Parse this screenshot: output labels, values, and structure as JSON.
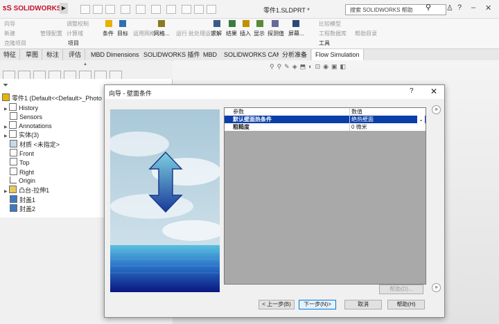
{
  "app": {
    "brand": "SOLIDWORKS",
    "document_title": "零件1.SLDPRT *"
  },
  "search": {
    "placeholder": "搜索 SOLIDWORKS 帮助"
  },
  "ribbon": {
    "left_items": [
      "向导",
      "新建",
      "克隆项目",
      "管理配置",
      "调整校制",
      "计算域",
      "条件",
      "目标",
      "项目",
      "运用网格",
      "网格...",
      "运行",
      "批处理运行",
      "求解",
      "结果",
      "插入",
      "显示",
      "探测值",
      "屏幕...",
      "比较模型",
      "工程数据库",
      "工具",
      "帮助目录"
    ]
  },
  "tabs": [
    {
      "label": "特征",
      "active": false
    },
    {
      "label": "草图",
      "active": false
    },
    {
      "label": "标注",
      "active": false
    },
    {
      "label": "评估",
      "active": false
    },
    {
      "label": "MBD Dimensions",
      "active": false
    },
    {
      "label": "SOLIDWORKS 插件",
      "active": false
    },
    {
      "label": "MBD",
      "active": false
    },
    {
      "label": "SOLIDWORKS CAM",
      "active": false
    },
    {
      "label": "分析准备",
      "active": false
    },
    {
      "label": "Flow Simulation",
      "active": true
    }
  ],
  "tree": {
    "root": "零件1 (Default<<Default>_Photo",
    "items": [
      "History",
      "Sensors",
      "Annotations",
      "实体(3)",
      "材质 <未指定>",
      "Front",
      "Top",
      "Right",
      "Origin",
      "凸台-拉伸1",
      "封盖1",
      "封盖2"
    ]
  },
  "dialog": {
    "title": "向导 - 壁面条件",
    "help": "?",
    "grid_header": {
      "param": "参数",
      "value": "数值"
    },
    "rows": [
      {
        "param": "默认壁面热条件",
        "value": "绝热壁面",
        "selected": true
      },
      {
        "param": "粗糙度",
        "value": "0 微米",
        "selected": false
      }
    ],
    "buttons": {
      "back": "< 上一步(B)",
      "next": "下一步(N)>",
      "cancel": "取消",
      "help": "帮助(H)",
      "grid_disabled": "帮助(D)..."
    }
  },
  "colors": {
    "selected_row": "#0a3fa8",
    "brand": "#c8102e"
  }
}
